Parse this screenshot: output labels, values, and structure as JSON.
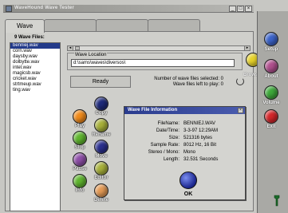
{
  "window": {
    "title": "WaveHound Wave Tester",
    "buttons": [
      "_",
      "□",
      "×"
    ]
  },
  "tabs": [
    {
      "label": "Wave",
      "active": true
    },
    {
      "label": "",
      "active": false
    },
    {
      "label": "",
      "active": false
    },
    {
      "label": "",
      "active": false
    }
  ],
  "files": {
    "heading": "9 Wave Files:",
    "items": [
      "benniej.wav",
      "corn.wav",
      "daysby.wav",
      "dolbytte.wav",
      "intel.wav",
      "magicsb.wav",
      "cricket.wav",
      "strtmeup.wav",
      "ting.wav"
    ],
    "selected_index": 0
  },
  "location": {
    "label": "Wave Location",
    "value": "d:\\sams\\waves\\diversos\\"
  },
  "status": {
    "ready": "Ready",
    "selected_line": "Number of wave files selected: 0",
    "left_line": "Wave files left to play: 0"
  },
  "browse": {
    "label": "Browse",
    "color": "#e6d22a"
  },
  "controls": [
    {
      "label": "Play",
      "color": "#f08a1a"
    },
    {
      "label": "Copy",
      "color": "#1e2a7a"
    },
    {
      "label": "Stop",
      "color": "#5fb52e"
    },
    {
      "label": "Rename",
      "color": "#a7b03a"
    },
    {
      "label": "Pause",
      "color": "#8e4fa8"
    },
    {
      "label": "Move",
      "color": "#2a2f8e"
    },
    {
      "label": "Info",
      "color": "#5fb52e"
    },
    {
      "label": "Editor",
      "color": "#a7b03a"
    },
    {
      "label": "Delete",
      "color": "#e39a55"
    }
  ],
  "dialog": {
    "title": "Wave File Information",
    "rows": [
      {
        "key": "FileName:",
        "value": "BENNIEJ.WAV"
      },
      {
        "key": "Date/Time:",
        "value": "3-3-97 12:29AM"
      },
      {
        "key": "Size:",
        "value": "521316 bytes"
      },
      {
        "key": "Sample Rate:",
        "value": "8012 Hz, 16 Bit"
      },
      {
        "key": "Stereo / Mono:",
        "value": "Mono"
      },
      {
        "key": "Length:",
        "value": "32.531 Seconds"
      }
    ],
    "ok_label": "OK"
  },
  "sidebar": [
    {
      "label": "Setup",
      "color": "#3b63c9"
    },
    {
      "label": "About",
      "color": "#b0508e"
    },
    {
      "label": "Volume",
      "color": "#3da83a"
    },
    {
      "label": "Exit",
      "color": "#d4262a"
    }
  ]
}
